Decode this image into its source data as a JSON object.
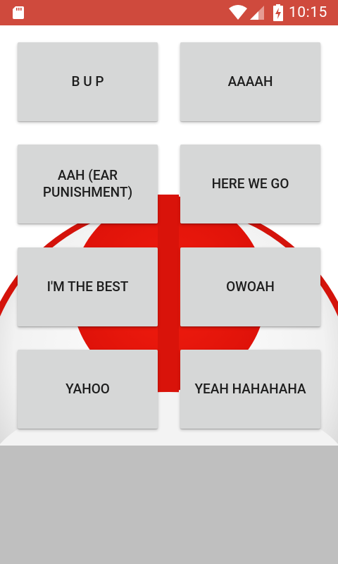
{
  "status_bar": {
    "time": "10:15",
    "icons": [
      "sd-card-icon",
      "wifi-icon",
      "signal-icon",
      "battery-charging-icon"
    ],
    "background_color": "#cf4a3d"
  },
  "buttons": [
    {
      "label": "B U P"
    },
    {
      "label": "AAAAH"
    },
    {
      "label": "AAH (EAR PUNISHMENT)"
    },
    {
      "label": "HERE WE GO"
    },
    {
      "label": "I'M THE BEST"
    },
    {
      "label": "OWOAH"
    },
    {
      "label": "YAHOO"
    },
    {
      "label": "YEAH HAHAHAHA"
    }
  ],
  "colors": {
    "button_bg": "#d6d7d7",
    "background_bottom": "#bfbfbf",
    "accent_red": "#e3120b"
  }
}
